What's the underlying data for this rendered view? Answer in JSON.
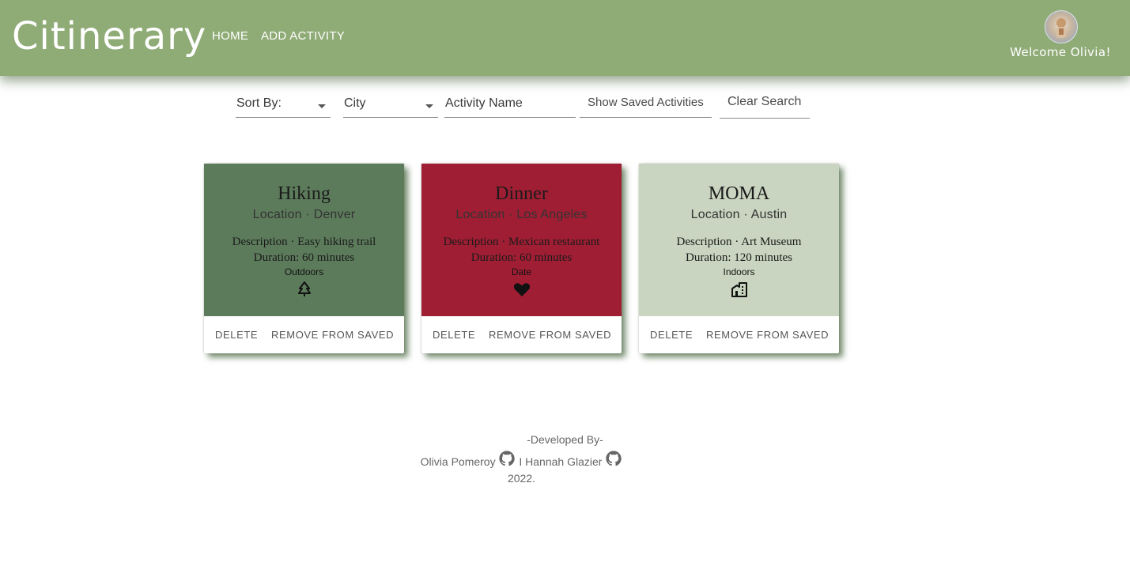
{
  "header": {
    "brand": "Citinerary",
    "nav": [
      "HOME",
      "ADD ACTIVITY"
    ],
    "welcome": "Welcome Olivia!"
  },
  "filters": {
    "sort_label": "Sort By:",
    "city_label": "City",
    "activity_placeholder": "Activity Name",
    "show_saved": "Show Saved Activities",
    "clear_search": "Clear Search"
  },
  "cards": [
    {
      "title": "Hiking",
      "location_label": "Location",
      "location": "Denver",
      "description_label": "Description",
      "description": "Easy hiking trail",
      "duration": "Duration: 60 minutes",
      "category": "Outdoors",
      "icon": "tree-icon",
      "color": "#5c7b5b",
      "delete": "DELETE",
      "remove": "REMOVE FROM SAVED"
    },
    {
      "title": "Dinner",
      "location_label": "Location",
      "location": "Los Angeles",
      "description_label": "Description",
      "description": "Mexican restaurant",
      "duration": "Duration: 60 minutes",
      "category": "Date",
      "icon": "heart-icon",
      "color": "#a01e33",
      "delete": "DELETE",
      "remove": "REMOVE FROM SAVED"
    },
    {
      "title": "MOMA",
      "location_label": "Location",
      "location": "Austin",
      "description_label": "Description",
      "description": "Art Museum",
      "duration": "Duration: 120 minutes",
      "category": "Indoors",
      "icon": "building-icon",
      "color": "#c9d5c0",
      "delete": "DELETE",
      "remove": "REMOVE FROM SAVED"
    }
  ],
  "footer": {
    "developed_by": "-Developed By-",
    "dev1": "Olivia Pomeroy",
    "separator": "I",
    "dev2": "Hannah Glazier",
    "year": "2022."
  },
  "colors": {
    "header_bg": "#8fab76",
    "page_bg": "#ffffff"
  }
}
